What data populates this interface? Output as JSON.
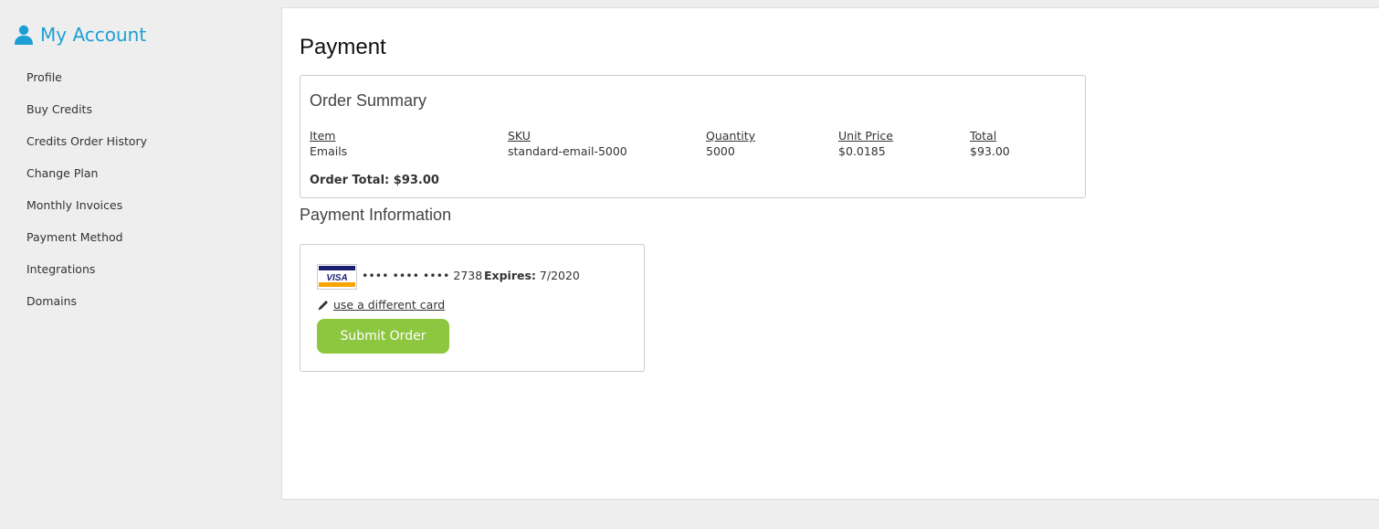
{
  "sidebar": {
    "title": "My Account",
    "items": [
      {
        "label": "Profile"
      },
      {
        "label": "Buy Credits"
      },
      {
        "label": "Credits Order History"
      },
      {
        "label": "Change Plan"
      },
      {
        "label": "Monthly Invoices"
      },
      {
        "label": "Payment Method"
      },
      {
        "label": "Integrations"
      },
      {
        "label": "Domains"
      }
    ]
  },
  "main": {
    "title": "Payment",
    "order_summary": {
      "title": "Order Summary",
      "columns": [
        "Item",
        "SKU",
        "Quantity",
        "Unit Price",
        "Total"
      ],
      "rows": [
        [
          "Emails",
          "standard-email-5000",
          "5000",
          "$0.0185",
          "$93.00"
        ]
      ],
      "total_label": "Order Total:",
      "total_value": "$93.00"
    },
    "payment_info": {
      "title": "Payment Information",
      "card_brand_icon": "visa-card-icon",
      "card_brand_text": "VISA",
      "card_number": "•••• •••• •••• 2738",
      "expires_label": "Expires:",
      "expires_value": "7/2020",
      "change_card_label": "use a different card",
      "submit_label": "Submit Order"
    }
  },
  "colors": {
    "accent": "#1e9fd3",
    "submit_button": "#8dc63f",
    "background": "#eeeeee"
  }
}
